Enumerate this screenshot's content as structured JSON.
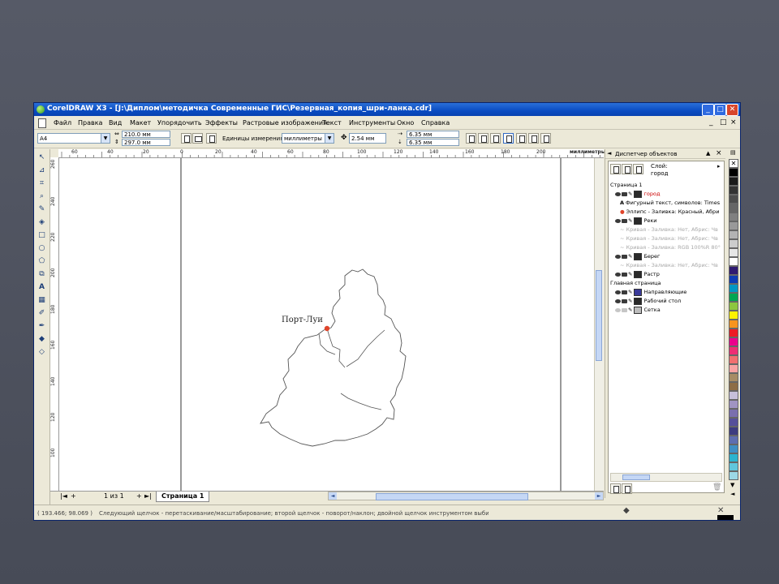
{
  "window": {
    "title": "CorelDRAW X3 - [J:\\Диплом\\методичка Современные ГИС\\Резервная_копия_шри-ланка.cdr]",
    "min": "_",
    "max": "□",
    "close": "✕"
  },
  "menu": {
    "items": [
      "Файл",
      "Правка",
      "Вид",
      "Макет",
      "Упорядочить",
      "Эффекты",
      "Растровые изображения",
      "Текст",
      "Инструменты",
      "Окно",
      "Справка"
    ],
    "right": [
      "_",
      "□",
      "×"
    ]
  },
  "props": {
    "paper": "A4",
    "width": "210.0 мм",
    "height": "297.0 мм",
    "units_label": "Единицы измерения:",
    "units_value": "миллиметры",
    "nudge": "2.54 мм",
    "dup_x": "6.35 мм",
    "dup_y": "6.35 мм"
  },
  "ruler": {
    "top": [
      "60",
      "40",
      "20",
      "0",
      "20",
      "40",
      "60",
      "80",
      "100",
      "120",
      "140",
      "160",
      "180",
      "200"
    ],
    "unit": "миллиметры",
    "left": [
      "260",
      "240",
      "220",
      "200",
      "180",
      "160",
      "140",
      "120",
      "100"
    ]
  },
  "map": {
    "city_label": "Порт-Луи",
    "colors": {
      "city": "#e0452b",
      "outline": "#555555"
    }
  },
  "pagetabs": {
    "first": "|◄",
    "add_left": "+",
    "counter": "1 из 1",
    "add_right": "+",
    "last": "►|",
    "page": "Страница 1"
  },
  "status": {
    "coords": "( 193.466; 98.069 )",
    "hint": "Следующий щелчок - перетаскивание/масштабирование; второй щелчок - поворот/наклон; двойной щелчок инструментом выбирает все объекты"
  },
  "docker": {
    "title": "Диспетчер объектов",
    "layer_label": "Слой:",
    "layer_name": "город",
    "tree": [
      {
        "label": "Страница 1",
        "indent": 0,
        "icons": false,
        "dim": false
      },
      {
        "label": "город",
        "indent": 1,
        "icons": true,
        "dim": false,
        "red": true,
        "swatch": "#2a2a2a"
      },
      {
        "label": "Фигурный текст, символов: Times",
        "indent": 2,
        "glyph": "A",
        "dim": false
      },
      {
        "label": "Эллипс - Заливка: Красный, Абри",
        "indent": 2,
        "glyph": "●",
        "dim": false
      },
      {
        "label": "Реки",
        "indent": 1,
        "icons": true,
        "dim": false,
        "swatch": "#2a2a2a"
      },
      {
        "label": "Кривая - Заливка: Нет, Абрис: Чв",
        "indent": 2,
        "glyph": "~",
        "dim": true
      },
      {
        "label": "Кривая - Заливка: Нет, Абрис: Чв",
        "indent": 2,
        "glyph": "~",
        "dim": true
      },
      {
        "label": "Кривая - Заливка: RGB 100%R 80°",
        "indent": 2,
        "glyph": "~",
        "dim": true
      },
      {
        "label": "Берег",
        "indent": 1,
        "icons": true,
        "dim": false,
        "swatch": "#2a2a2a"
      },
      {
        "label": "Кривая - Заливка: Нет, Абрис: Чв",
        "indent": 2,
        "glyph": "~",
        "dim": true
      },
      {
        "label": "Растр",
        "indent": 1,
        "icons": true,
        "dim": false,
        "swatch": "#2a2a2a"
      },
      {
        "label": "Главная страница",
        "indent": 0,
        "icons": false,
        "dim": false
      },
      {
        "label": "Направляющие",
        "indent": 1,
        "icons": true,
        "dim": false,
        "swatch": "#3a3a9a"
      },
      {
        "label": "Рабочий стол",
        "indent": 1,
        "icons": true,
        "dim": false,
        "swatch": "#2a2a2a"
      },
      {
        "label": "Сетка",
        "indent": 1,
        "icons": true,
        "dim": false,
        "swatch": "#bdbdbd",
        "dimicon": true
      }
    ]
  },
  "palette": [
    "#ffffff",
    "#000000",
    "#1a1a1a",
    "#333333",
    "#4d4d4d",
    "#666666",
    "#808080",
    "#999999",
    "#b3b3b3",
    "#cccccc",
    "#e6e6e6",
    "#ffffff",
    "#2e1a72",
    "#0d3cb5",
    "#0097c4",
    "#00a651",
    "#8dc63f",
    "#fff200",
    "#f7941d",
    "#ed1c24",
    "#ec008c",
    "#ee2e74",
    "#f26f6f",
    "#f9a3a3",
    "#a78c65",
    "#8d6d45",
    "#c6c0da",
    "#a094c2",
    "#7a6fae",
    "#56509a",
    "#3d3c80",
    "#5e6eb0",
    "#3f8fc4",
    "#2cb4cf",
    "#60c6dc",
    "#9cd8e6"
  ]
}
